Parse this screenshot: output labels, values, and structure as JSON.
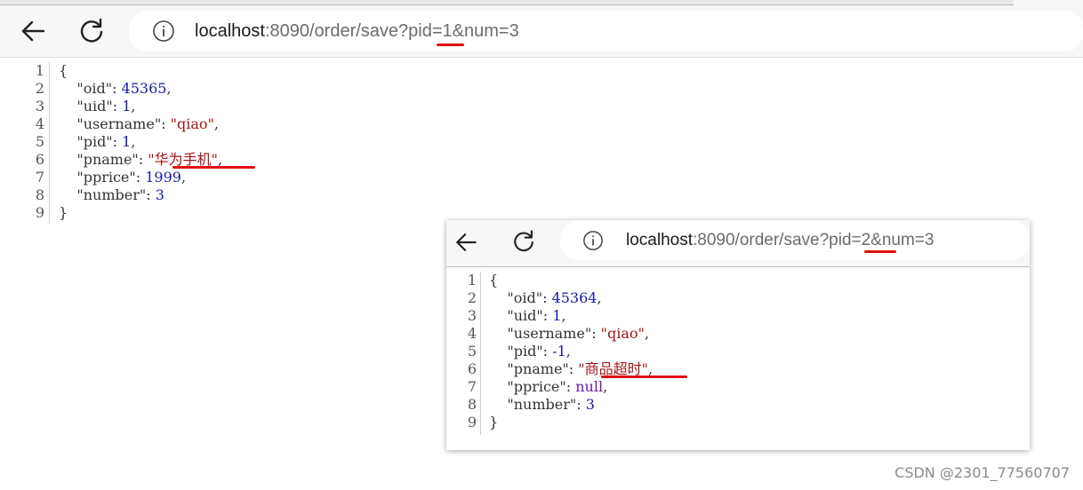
{
  "main_window": {
    "url_host": "localhost",
    "url_rest": ":8090/order/save?pid=1&num=3",
    "json_lines": [
      {
        "n": "1",
        "parts": [
          {
            "t": "{",
            "c": "punc"
          }
        ]
      },
      {
        "n": "2",
        "parts": [
          {
            "t": "    \"oid\"",
            "c": "key"
          },
          {
            "t": ": ",
            "c": "punc"
          },
          {
            "t": "45365",
            "c": "num"
          },
          {
            "t": ",",
            "c": "punc"
          }
        ]
      },
      {
        "n": "3",
        "parts": [
          {
            "t": "    \"uid\"",
            "c": "key"
          },
          {
            "t": ": ",
            "c": "punc"
          },
          {
            "t": "1",
            "c": "num"
          },
          {
            "t": ",",
            "c": "punc"
          }
        ]
      },
      {
        "n": "4",
        "parts": [
          {
            "t": "    \"username\"",
            "c": "key"
          },
          {
            "t": ": ",
            "c": "punc"
          },
          {
            "t": "\"qiao\"",
            "c": "str"
          },
          {
            "t": ",",
            "c": "punc"
          }
        ]
      },
      {
        "n": "5",
        "parts": [
          {
            "t": "    \"pid\"",
            "c": "key"
          },
          {
            "t": ": ",
            "c": "punc"
          },
          {
            "t": "1",
            "c": "num"
          },
          {
            "t": ",",
            "c": "punc"
          }
        ]
      },
      {
        "n": "6",
        "parts": [
          {
            "t": "    \"pname\"",
            "c": "key"
          },
          {
            "t": ": ",
            "c": "punc"
          },
          {
            "t": "\"华为手机\"",
            "c": "str"
          },
          {
            "t": ",",
            "c": "punc"
          }
        ]
      },
      {
        "n": "7",
        "parts": [
          {
            "t": "    \"pprice\"",
            "c": "key"
          },
          {
            "t": ": ",
            "c": "punc"
          },
          {
            "t": "1999",
            "c": "num"
          },
          {
            "t": ",",
            "c": "punc"
          }
        ]
      },
      {
        "n": "8",
        "parts": [
          {
            "t": "    \"number\"",
            "c": "key"
          },
          {
            "t": ": ",
            "c": "punc"
          },
          {
            "t": "3",
            "c": "num"
          }
        ]
      },
      {
        "n": "9",
        "parts": [
          {
            "t": "}",
            "c": "punc"
          }
        ]
      }
    ]
  },
  "popup_window": {
    "url_host": "localhost",
    "url_rest": ":8090/order/save?pid=2&num=3",
    "json_lines": [
      {
        "n": "1",
        "parts": [
          {
            "t": "{",
            "c": "punc"
          }
        ]
      },
      {
        "n": "2",
        "parts": [
          {
            "t": "    \"oid\"",
            "c": "key"
          },
          {
            "t": ": ",
            "c": "punc"
          },
          {
            "t": "45364",
            "c": "num"
          },
          {
            "t": ",",
            "c": "punc"
          }
        ]
      },
      {
        "n": "3",
        "parts": [
          {
            "t": "    \"uid\"",
            "c": "key"
          },
          {
            "t": ": ",
            "c": "punc"
          },
          {
            "t": "1",
            "c": "num"
          },
          {
            "t": ",",
            "c": "punc"
          }
        ]
      },
      {
        "n": "4",
        "parts": [
          {
            "t": "    \"username\"",
            "c": "key"
          },
          {
            "t": ": ",
            "c": "punc"
          },
          {
            "t": "\"qiao\"",
            "c": "str"
          },
          {
            "t": ",",
            "c": "punc"
          }
        ]
      },
      {
        "n": "5",
        "parts": [
          {
            "t": "    \"pid\"",
            "c": "key"
          },
          {
            "t": ": ",
            "c": "punc"
          },
          {
            "t": "-1",
            "c": "num"
          },
          {
            "t": ",",
            "c": "punc"
          }
        ]
      },
      {
        "n": "6",
        "parts": [
          {
            "t": "    \"pname\"",
            "c": "key"
          },
          {
            "t": ": ",
            "c": "punc"
          },
          {
            "t": "\"商品超时\"",
            "c": "str"
          },
          {
            "t": ",",
            "c": "punc"
          }
        ]
      },
      {
        "n": "7",
        "parts": [
          {
            "t": "    \"pprice\"",
            "c": "key"
          },
          {
            "t": ": ",
            "c": "punc"
          },
          {
            "t": "null",
            "c": "nul"
          },
          {
            "t": ",",
            "c": "punc"
          }
        ]
      },
      {
        "n": "8",
        "parts": [
          {
            "t": "    \"number\"",
            "c": "key"
          },
          {
            "t": ": ",
            "c": "punc"
          },
          {
            "t": "3",
            "c": "num"
          }
        ]
      },
      {
        "n": "9",
        "parts": [
          {
            "t": "}",
            "c": "punc"
          }
        ]
      }
    ]
  },
  "icons": {
    "back": "back-arrow-icon",
    "reload": "reload-icon",
    "info": "info-icon"
  },
  "colors": {
    "annotation": "#e01010",
    "number": "#1a1aa6",
    "string": "#a31515",
    "null": "#6a1b9a"
  },
  "watermark": "CSDN @2301_77560707"
}
